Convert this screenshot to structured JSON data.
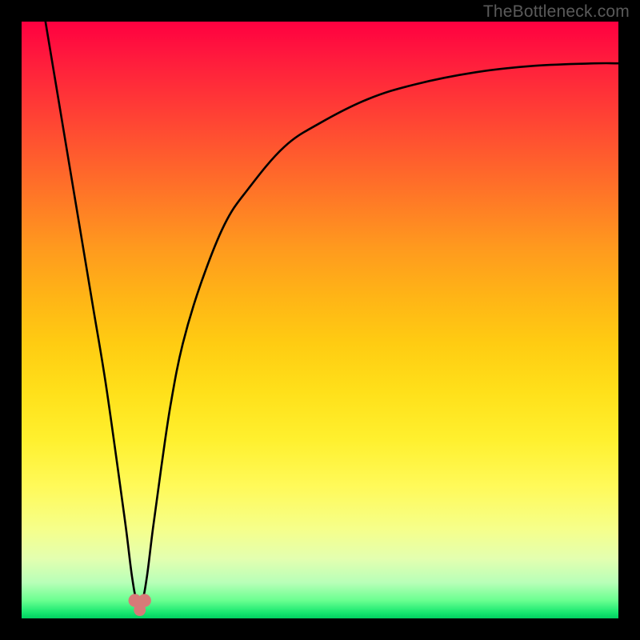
{
  "watermark": "TheBottleneck.com",
  "chart_data": {
    "type": "line",
    "title": "",
    "xlabel": "",
    "ylabel": "",
    "xlim": [
      0,
      100
    ],
    "ylim": [
      0,
      100
    ],
    "grid": false,
    "legend": false,
    "background_gradient": {
      "top": "#ff0040",
      "top_mid": "#ff9a1e",
      "mid": "#fff02e",
      "bottom_mid": "#b8ffb8",
      "bottom": "#00d060"
    },
    "series": [
      {
        "name": "bottleneck-curve",
        "color": "#000000",
        "x": [
          4.0,
          6.0,
          8.0,
          10.0,
          12.0,
          14.0,
          16.0,
          17.5,
          18.5,
          19.3,
          20.2,
          21.0,
          22.0,
          23.5,
          25.0,
          27.0,
          30.0,
          34.0,
          38.0,
          44.0,
          50.0,
          58.0,
          66.0,
          76.0,
          86.0,
          96.0,
          100.0
        ],
        "y": [
          100.0,
          88.0,
          76.0,
          64.0,
          52.0,
          40.0,
          26.0,
          15.0,
          7.0,
          3.0,
          3.0,
          7.0,
          15.0,
          26.0,
          36.0,
          46.0,
          56.0,
          66.0,
          72.0,
          79.0,
          83.0,
          87.0,
          89.5,
          91.5,
          92.6,
          93.0,
          93.0
        ]
      }
    ],
    "markers": [
      {
        "name": "min-marker-left",
        "x": 19.0,
        "y": 3.0,
        "color": "#d77a78",
        "r": 1.1
      },
      {
        "name": "min-marker-right",
        "x": 20.6,
        "y": 3.0,
        "color": "#d77a78",
        "r": 1.1
      },
      {
        "name": "min-marker-bottom",
        "x": 19.8,
        "y": 1.4,
        "color": "#d77a78",
        "r": 1.0
      }
    ]
  }
}
